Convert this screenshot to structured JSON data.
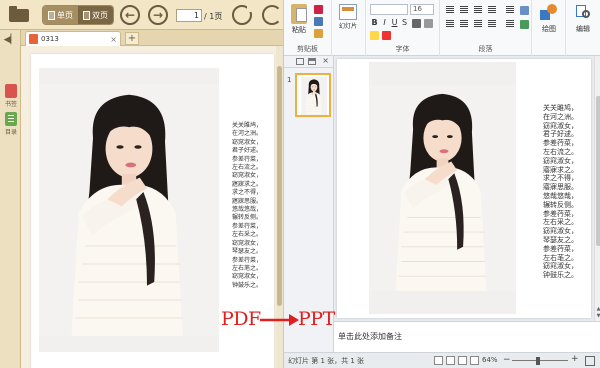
{
  "pdf_reader": {
    "toolbar": {
      "single_page_label": "单页",
      "double_page_label": "双页",
      "current_page": "1",
      "total_pages": "/ 1页"
    },
    "sidebar": {
      "bookmark_label": "书签",
      "outline_label": "目录"
    },
    "tab": {
      "title": "0313",
      "close_symbol": "×",
      "new_tab_symbol": "+"
    },
    "poem_lines": [
      "关关雎鸠，",
      "在河之洲。",
      "窈窕淑女，",
      "君子好逑。",
      "参差荇菜，",
      "左右流之。",
      "窈窕淑女，",
      "寤寐求之。",
      "求之不得，",
      "寤寐思服。",
      "悠哉悠哉，",
      "辗转反侧。",
      "参差荇菜，",
      "左右采之。",
      "窈窕淑女，",
      "琴瑟友之。",
      "参差荇菜，",
      "左右芼之。",
      "窈窕淑女，",
      "钟鼓乐之。"
    ]
  },
  "ppt": {
    "ribbon": {
      "paste_label": "粘贴",
      "new_slide_label": "幻灯片",
      "clipboard_group": "剪贴板",
      "font_group": "字体",
      "font_size": "16",
      "paragraph_group": "段落",
      "drawing_label": "绘图",
      "editing_label": "编辑",
      "bold": "B",
      "italic": "I",
      "underline": "U",
      "strike": "S"
    },
    "slide_panel": {
      "slide_number": "1"
    },
    "notes_placeholder": "单击此处添加备注",
    "status": {
      "slide_info": "幻灯片 第 1 张，共 1 张",
      "zoom": "64%"
    }
  },
  "overlay": {
    "from": "PDF",
    "to": "PPT"
  },
  "colors": {
    "pdf_toolbar_bg": "#f2e6c7",
    "accent_red": "#e02020",
    "ppt_ribbon_bg": "#f8f9fa",
    "selected_slide_border": "#f0b040"
  }
}
